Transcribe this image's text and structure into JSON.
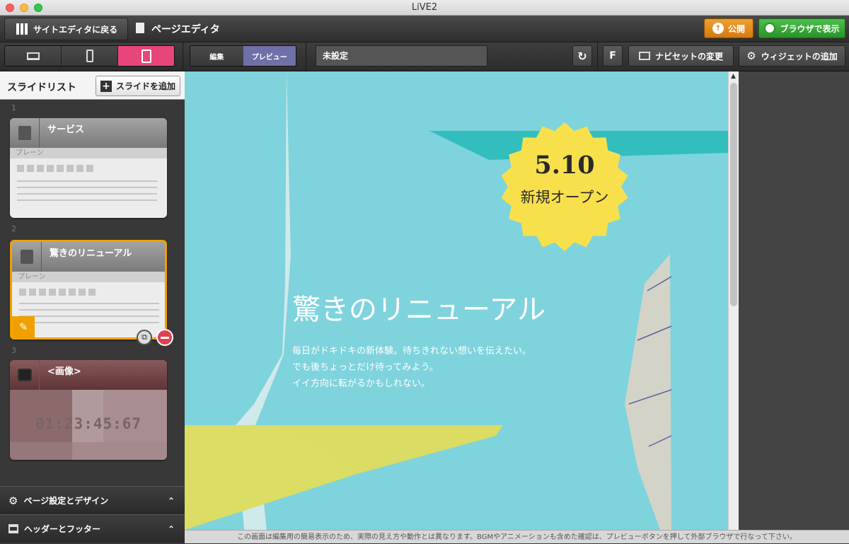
{
  "window": {
    "title": "LiVE2"
  },
  "topbar": {
    "back_label": "サイトエディタに戻る",
    "page_title": "ページエディタ",
    "publish_label": "公開",
    "browser_label": "ブラウザで表示"
  },
  "toolbar": {
    "mode_edit": "編集",
    "mode_preview": "プレビュー",
    "page_name_value": "未設定",
    "f_label": "F",
    "navset_label": "ナビセットの変更",
    "widget_label": "ウィジェットの追加"
  },
  "sidebar": {
    "heading": "スライドリスト",
    "add_slide_label": "スライドを追加",
    "slides": [
      {
        "number": "1",
        "title": "サービス",
        "type": "プレーン"
      },
      {
        "number": "2",
        "title": "驚きのリニューアル",
        "type": "プレーン"
      },
      {
        "number": "3",
        "title": "<画像>",
        "timer": "01:23:45:67"
      }
    ],
    "page_settings_label": "ページ設定とデザイン",
    "header_footer_label": "ヘッダーとフッター"
  },
  "preview": {
    "badge_date": "5.10",
    "badge_text": "新規オープン",
    "headline": "驚きのリニューアル",
    "body_lines": [
      "毎日がドキドキの新体験。待ちきれない想いを伝えたい。",
      "でも後ちょっとだけ待ってみよう。",
      "イイ方向に転がるかもしれない。"
    ]
  },
  "footer": {
    "note": "この画面は編集用の簡易表示のため、実際の見え方や動作とは異なります。BGMやアニメーションも含めた確認は、プレビューボタンを押して外部ブラウザで行なって下さい。"
  },
  "colors": {
    "accent_pink": "#e8467a",
    "preview_purple": "#7070a8",
    "publish_orange": "#e08a1c",
    "browser_green": "#3aa63a",
    "selected_border": "#f0a000",
    "badge_yellow": "#f8e04c"
  },
  "icons": [
    "laptop-icon",
    "phone-icon",
    "tablet-icon",
    "refresh-icon",
    "navset-icon",
    "gear-icon",
    "document-icon",
    "camera-icon",
    "pencil-icon",
    "duplicate-icon",
    "remove-icon",
    "globe-icon",
    "publish-icon",
    "plus-icon",
    "grid-icon",
    "chevron-up-icon",
    "scroll-up-arrow-icon"
  ]
}
